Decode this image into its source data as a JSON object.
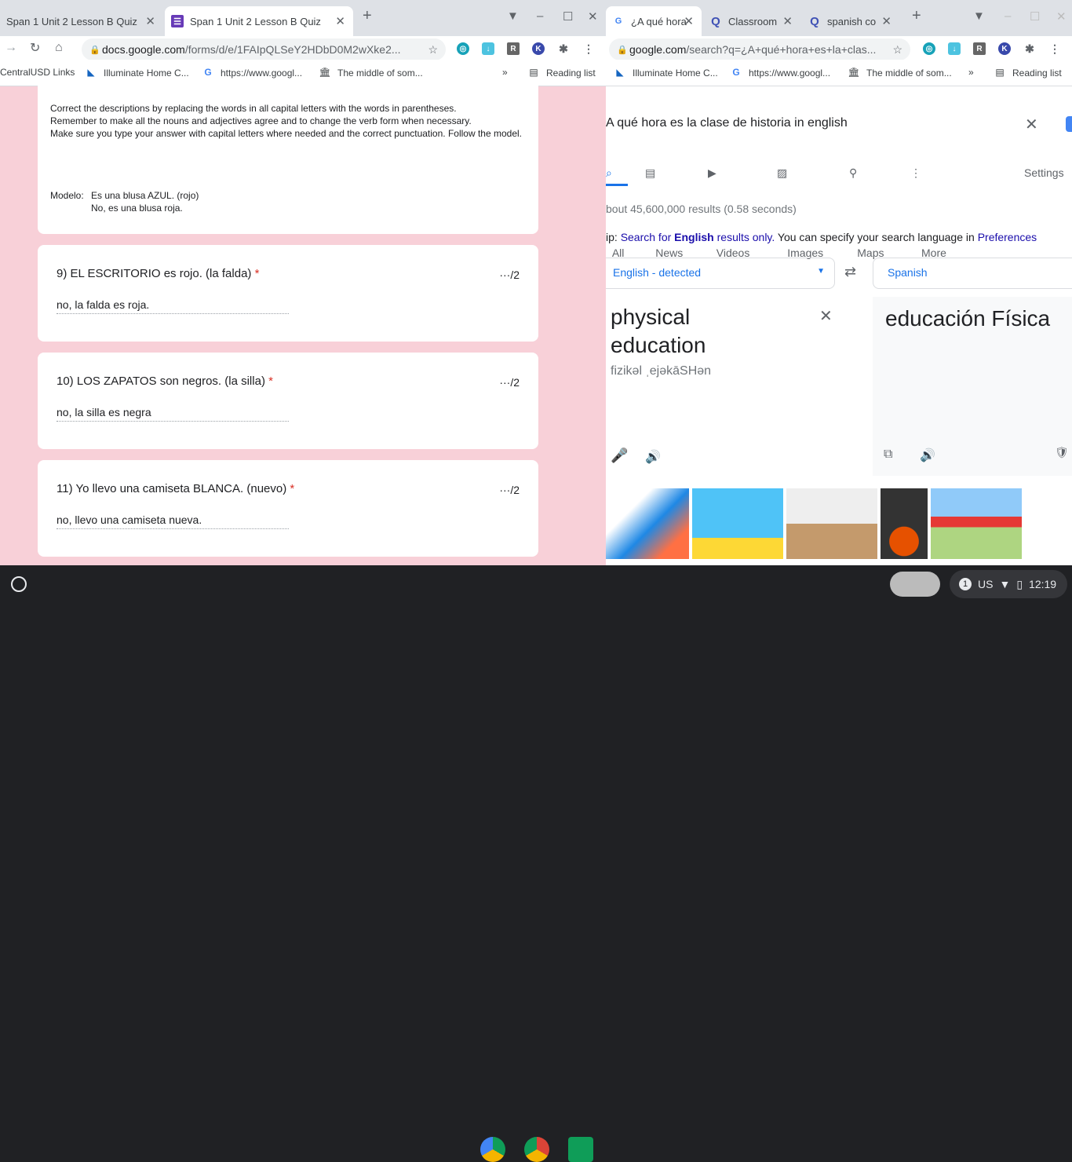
{
  "left_window": {
    "tabs": [
      {
        "title": "Span 1 Unit 2 Lesson B Quiz"
      },
      {
        "title": "Span 1 Unit 2 Lesson B Quiz"
      }
    ],
    "url_host": "docs.google.com",
    "url_path": "/forms/d/e/1FAIpQLSeY2HDbD0M2wXke2...",
    "bookmarks": [
      "CentralUSD Links",
      "Illuminate Home C...",
      "https://www.googl...",
      "The middle of som..."
    ],
    "reading_list": "Reading list",
    "instructions": [
      "Correct the descriptions by replacing the words in all capital letters with the words in parentheses.",
      "Remember to make all the nouns and adjectives agree and to change the verb form when necessary.",
      "Make sure you type your answer with capital letters where needed and the correct punctuation.  Follow the model."
    ],
    "model_label": "Modelo:",
    "model_line1": "Es una blusa AZUL. (rojo)",
    "model_line2": "No, es una blusa roja.",
    "questions": [
      {
        "title": "9) EL ESCRITORIO es rojo. (la falda)",
        "points": "···/2",
        "answer": "no, la falda es roja."
      },
      {
        "title": "10) LOS ZAPATOS son negros. (la silla)",
        "points": "···/2",
        "answer": "no, la silla es negra"
      },
      {
        "title": "11) Yo llevo una camiseta BLANCA. (nuevo)",
        "points": "···/2",
        "answer": "no, llevo una camiseta nueva."
      }
    ]
  },
  "right_window": {
    "tabs": [
      {
        "title": "¿A qué hora"
      },
      {
        "title": "Classroom"
      },
      {
        "title": "spanish co"
      }
    ],
    "url_host": "google.com",
    "url_path": "/search?q=¿A+qué+hora+es+la+clas...",
    "bookmarks": [
      "Illuminate Home C...",
      "https://www.googl...",
      "The middle of som..."
    ],
    "reading_list": "Reading list",
    "query": "A qué hora es la clase de historia in english",
    "search_tabs": [
      "All",
      "News",
      "Videos",
      "Images",
      "Maps",
      "More"
    ],
    "settings": "Settings",
    "result_stats": "bout 45,600,000 results (0.58 seconds)",
    "tip_prefix": "ip: ",
    "tip_link1": "Search for ",
    "tip_bold": "English",
    "tip_link2": " results only.",
    "tip_mid": " You can specify your search language in ",
    "tip_pref": "Preferences",
    "source_lang": "English - detected",
    "target_lang": "Spanish",
    "source_text": "physical education",
    "pronunciation": "fizikəl ˌejəkāSHən",
    "translation": "educación Física"
  },
  "shelf": {
    "notification_count": "1",
    "keyboard": "US",
    "time": "12:19"
  }
}
